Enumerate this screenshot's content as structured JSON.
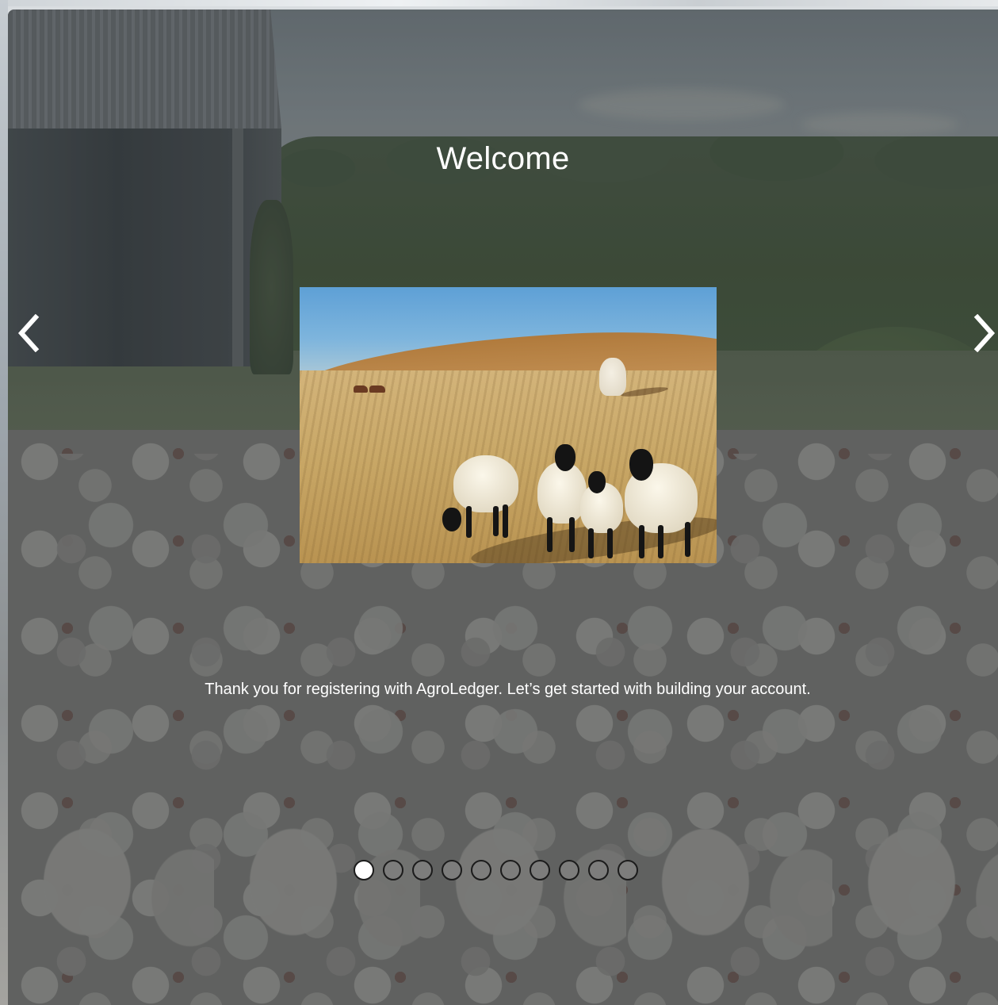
{
  "welcome": {
    "title": "Welcome",
    "message": "Thank you for registering with AgroLedger. Let’s get started with building your account."
  },
  "carousel": {
    "previous_icon": "chevron-left-icon",
    "next_icon": "chevron-right-icon",
    "total_slides": 10,
    "active_index": 0
  },
  "colors": {
    "text": "#ffffff",
    "dot_active": "#ffffff",
    "dot_inactive": "#7d7d7c",
    "dot_border": "#1b1b1b"
  }
}
